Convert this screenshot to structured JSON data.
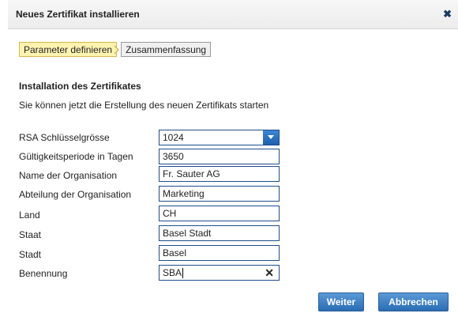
{
  "dialog": {
    "title": "Neues Zertifikat installieren",
    "close_icon": "close-icon"
  },
  "steps": [
    "Parameter definieren",
    "Zusammenfassung"
  ],
  "section_title": "Installation des Zertifikates",
  "intro": "Sie können jetzt die Erstellung des neuen Zertifikats starten",
  "form": {
    "rsa_label": "RSA Schlüsselgrösse",
    "rsa_value": "1024",
    "validity_label": "Gültigkeitsperiode in Tagen",
    "validity_value": "3650",
    "org_label": "Name der Organisation",
    "org_value": "Fr. Sauter AG",
    "dept_label": "Abteilung der Organisation",
    "dept_value": "Marketing",
    "country_label": "Land",
    "country_value": "CH",
    "state_label": "Staat",
    "state_value": "Basel Stadt",
    "city_label": "Stadt",
    "city_value": "Basel",
    "name_label": "Benennung",
    "name_value": "SBA"
  },
  "buttons": {
    "next": "Weiter",
    "cancel": "Abbrechen"
  },
  "colors": {
    "active_step": "#fff3b0",
    "button_blue": "#2a6cb3",
    "field_border": "#1f4e8c"
  }
}
